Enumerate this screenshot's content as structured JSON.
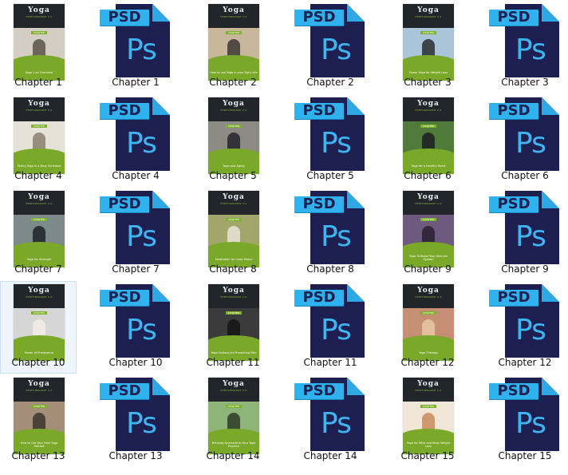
{
  "items": [
    {
      "label": "Chapter 1",
      "type": "cover",
      "title": "Yoga 1 an Overview",
      "photo": "#d4cdc4",
      "figure": "#5a5248"
    },
    {
      "label": "Chapter 1",
      "type": "psd",
      "tag": "PSD",
      "mark": "Ps"
    },
    {
      "label": "Chapter 2",
      "type": "cover",
      "title": "How to use Yoga in your Daily Life",
      "photo": "#c9b79b",
      "figure": "#3b3a36"
    },
    {
      "label": "Chapter 2",
      "type": "psd",
      "tag": "PSD",
      "mark": "Ps"
    },
    {
      "label": "Chapter 3",
      "type": "cover",
      "title": "Power Yoga for Weight Loss",
      "photo": "#aac4d8",
      "figure": "#2b2d30"
    },
    {
      "label": "Chapter 3",
      "type": "psd",
      "tag": "PSD",
      "mark": "Ps"
    },
    {
      "label": "Chapter 4",
      "type": "cover",
      "title": "Fitting Yoga in a Busy Schedule",
      "photo": "#e7e2d8",
      "figure": "#8a7f6e"
    },
    {
      "label": "Chapter 4",
      "type": "psd",
      "tag": "PSD",
      "mark": "Ps"
    },
    {
      "label": "Chapter 5",
      "type": "cover",
      "title": "Yoga and Aging",
      "photo": "#8b8b84",
      "figure": "#24242a"
    },
    {
      "label": "Chapter 5",
      "type": "psd",
      "tag": "PSD",
      "mark": "Ps"
    },
    {
      "label": "Chapter 6",
      "type": "cover",
      "title": "Yoga for a Healthy Heart",
      "photo": "#4e7a3a",
      "figure": "#1e1f24"
    },
    {
      "label": "Chapter 6",
      "type": "psd",
      "tag": "PSD",
      "mark": "Ps"
    },
    {
      "label": "Chapter 7",
      "type": "cover",
      "title": "Yoga for Strength",
      "photo": "#7d8a8c",
      "figure": "#1f2224"
    },
    {
      "label": "Chapter 7",
      "type": "psd",
      "tag": "PSD",
      "mark": "Ps"
    },
    {
      "label": "Chapter 8",
      "type": "cover",
      "title": "Meditation for Inner Peace",
      "photo": "#a2a66a",
      "figure": "#e9e3d6"
    },
    {
      "label": "Chapter 8",
      "type": "psd",
      "tag": "PSD",
      "mark": "Ps"
    },
    {
      "label": "Chapter 9",
      "type": "cover",
      "title": "Yoga To Boost Your Immune System",
      "photo": "#6e5a7f",
      "figure": "#2a2030"
    },
    {
      "label": "Chapter 9",
      "type": "psd",
      "tag": "PSD",
      "mark": "Ps"
    },
    {
      "label": "Chapter 10",
      "type": "cover",
      "title": "Power of Pranayama",
      "photo": "#d6d6d6",
      "figure": "#f2efe9"
    },
    {
      "label": "Chapter 10",
      "type": "psd",
      "tag": "PSD",
      "mark": "Ps"
    },
    {
      "label": "Chapter 11",
      "type": "cover",
      "title": "Yoga Options for Preventing Pain",
      "photo": "#3b3b3b",
      "figure": "#151515"
    },
    {
      "label": "Chapter 11",
      "type": "psd",
      "tag": "PSD",
      "mark": "Ps"
    },
    {
      "label": "Chapter 12",
      "type": "cover",
      "title": "Yoga Therapy",
      "photo": "#c68e74",
      "figure": "#e7c8a8"
    },
    {
      "label": "Chapter 12",
      "type": "psd",
      "tag": "PSD",
      "mark": "Ps"
    },
    {
      "label": "Chapter 13",
      "type": "cover",
      "title": "How to Get Your Own Yoga Retreat",
      "photo": "#a58e77",
      "figure": "#3a342c"
    },
    {
      "label": "Chapter 13",
      "type": "psd",
      "tag": "PSD",
      "mark": "Ps"
    },
    {
      "label": "Chapter 14",
      "type": "cover",
      "title": "Bringing Ayurveda to Your Yoga Practice",
      "photo": "#8fb47a",
      "figure": "#2c3b27"
    },
    {
      "label": "Chapter 14",
      "type": "psd",
      "tag": "PSD",
      "mark": "Ps"
    },
    {
      "label": "Chapter 15",
      "type": "cover",
      "title": "Yoga for Mind and Body Weight Loss",
      "photo": "#efe6d8",
      "figure": "#c98b5b"
    },
    {
      "label": "Chapter 15",
      "type": "psd",
      "tag": "PSD",
      "mark": "Ps"
    }
  ],
  "cover_logo": "Yoga",
  "cover_logo_sub": "PERFORMANCE 2.0",
  "cover_band": "CHAPTER",
  "selected_index": 18,
  "colors": {
    "selection_bg": "#eef5fd",
    "selection_border": "#c8dff5",
    "psd_dark": "#1c1f4f",
    "psd_light": "#2fb2ee",
    "cover_green": "#7aa828",
    "cover_dark": "#22252a"
  }
}
